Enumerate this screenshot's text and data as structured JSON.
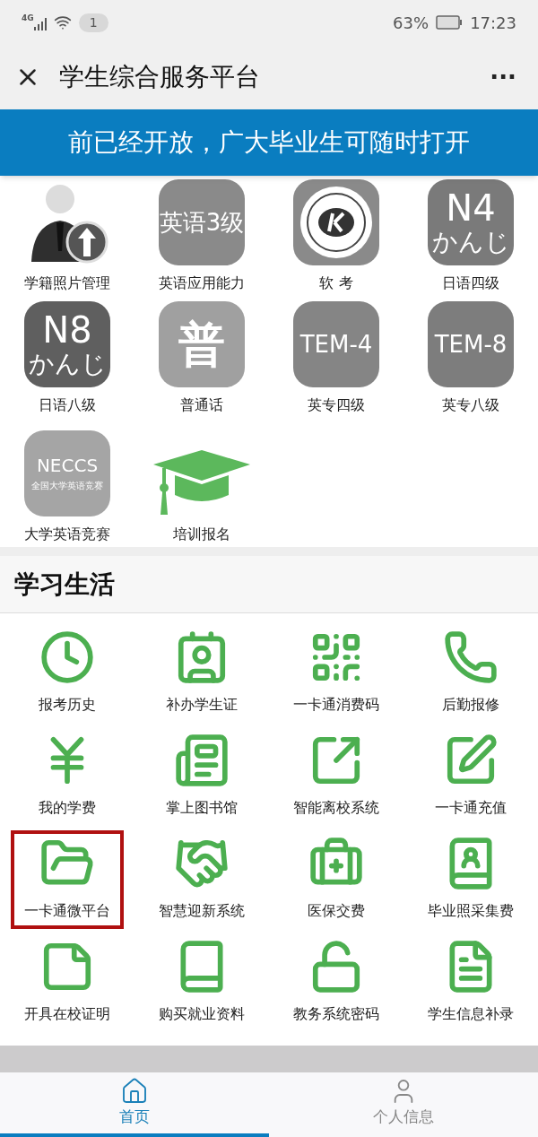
{
  "status_bar": {
    "network": "4G",
    "notifications": "1",
    "battery": "63%",
    "time": "17:23"
  },
  "title_bar": {
    "title": "学生综合服务平台",
    "more": "···"
  },
  "banner": {
    "text": "前已经开放，广大毕业生可随时打开"
  },
  "exam_items": [
    {
      "kind": "photo",
      "label": "学籍照片管理"
    },
    {
      "kind": "tile",
      "lines": [
        "英语3级"
      ],
      "label": "英语应用能力"
    },
    {
      "kind": "logo",
      "label": "软 考"
    },
    {
      "kind": "tile",
      "lines": [
        "N4",
        "かんじ"
      ],
      "label": "日语四级"
    },
    {
      "kind": "tile",
      "lines": [
        "N8",
        "かんじ"
      ],
      "label": "日语八级"
    },
    {
      "kind": "tile",
      "lines": [
        "普"
      ],
      "label": "普通话"
    },
    {
      "kind": "tile",
      "lines": [
        "TEM-4"
      ],
      "label": "英专四级"
    },
    {
      "kind": "tile",
      "lines": [
        "TEM-8"
      ],
      "label": "英专八级"
    },
    {
      "kind": "tile",
      "lines": [
        "NECCS",
        "全国大学英语竞赛"
      ],
      "label": "大学英语竞赛"
    },
    {
      "kind": "cap",
      "label": "培训报名"
    }
  ],
  "section": {
    "title": "学习生活"
  },
  "life_items": [
    {
      "label": "报考历史",
      "highlighted": false
    },
    {
      "label": "补办学生证",
      "highlighted": false
    },
    {
      "label": "一卡通消费码",
      "highlighted": false
    },
    {
      "label": "后勤报修",
      "highlighted": false
    },
    {
      "label": "我的学费",
      "highlighted": false
    },
    {
      "label": "掌上图书馆",
      "highlighted": false
    },
    {
      "label": "智能离校系统",
      "highlighted": false
    },
    {
      "label": "一卡通充值",
      "highlighted": false
    },
    {
      "label": "一卡通微平台",
      "highlighted": true
    },
    {
      "label": "智慧迎新系统",
      "highlighted": false
    },
    {
      "label": "医保交费",
      "highlighted": false
    },
    {
      "label": "毕业照采集费",
      "highlighted": false
    },
    {
      "label": "开具在校证明",
      "highlighted": false
    },
    {
      "label": "购买就业资料",
      "highlighted": false
    },
    {
      "label": "教务系统密码",
      "highlighted": false
    },
    {
      "label": "学生信息补录",
      "highlighted": false
    }
  ],
  "bottom_nav": [
    {
      "label": "首页",
      "selected": true
    },
    {
      "label": "个人信息",
      "selected": false
    }
  ]
}
